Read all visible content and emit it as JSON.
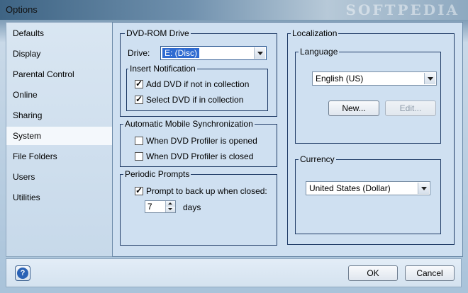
{
  "window": {
    "title": "Options",
    "watermark": "SOFTPEDIA"
  },
  "sidebar": {
    "items": [
      {
        "label": "Defaults"
      },
      {
        "label": "Display"
      },
      {
        "label": "Parental Control"
      },
      {
        "label": "Online"
      },
      {
        "label": "Sharing"
      },
      {
        "label": "System",
        "selected": true
      },
      {
        "label": "File Folders"
      },
      {
        "label": "Users"
      },
      {
        "label": "Utilities"
      }
    ]
  },
  "dvd_drive": {
    "group_label": "DVD-ROM Drive",
    "drive_label": "Drive:",
    "drive_value": "E: (Disc)",
    "insert_notification": {
      "label": "Insert Notification",
      "add_dvd": {
        "label": "Add DVD if not in collection",
        "checked": true
      },
      "select_dvd": {
        "label": "Select DVD if in collection",
        "checked": true
      }
    }
  },
  "mobile_sync": {
    "group_label": "Automatic Mobile Synchronization",
    "when_opened": {
      "label": "When DVD Profiler is opened",
      "checked": false
    },
    "when_closed": {
      "label": "When DVD Profiler is closed",
      "checked": false
    }
  },
  "periodic": {
    "group_label": "Periodic Prompts",
    "prompt_backup": {
      "label": "Prompt to back up when closed:",
      "checked": true
    },
    "days_value": "7",
    "days_label": "days"
  },
  "localization": {
    "group_label": "Localization",
    "language": {
      "label": "Language",
      "value": "English (US)",
      "new_button": "New...",
      "edit_button": "Edit..."
    },
    "currency": {
      "label": "Currency",
      "value": "United States (Dollar)"
    }
  },
  "footer": {
    "help_icon": "?",
    "ok_button": "OK",
    "cancel_button": "Cancel"
  },
  "colors": {
    "selection": "#2f6bd1",
    "group_border": "#1f3b66"
  }
}
